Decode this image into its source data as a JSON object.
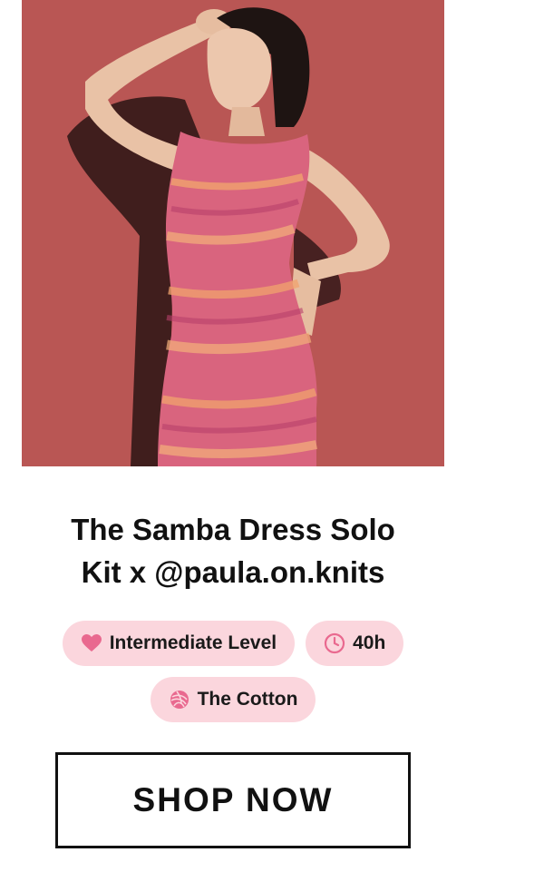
{
  "product": {
    "title_line1": "The Samba Dress Solo",
    "title_line2": "Kit x @paula.on.knits",
    "image_alt": "Woman wearing a pink knitted sleeveless dress against a red wall"
  },
  "tags": {
    "level": "Intermediate Level",
    "time": "40h",
    "yarn": "The Cotton"
  },
  "cta": {
    "label": "SHOP NOW"
  },
  "colors": {
    "tag_background": "#fbd6dd",
    "accent_icon": "#e9698f",
    "photo_background": "#b95654"
  },
  "icons": {
    "level": "heart-icon",
    "time": "clock-icon",
    "yarn": "yarn-ball-icon"
  }
}
